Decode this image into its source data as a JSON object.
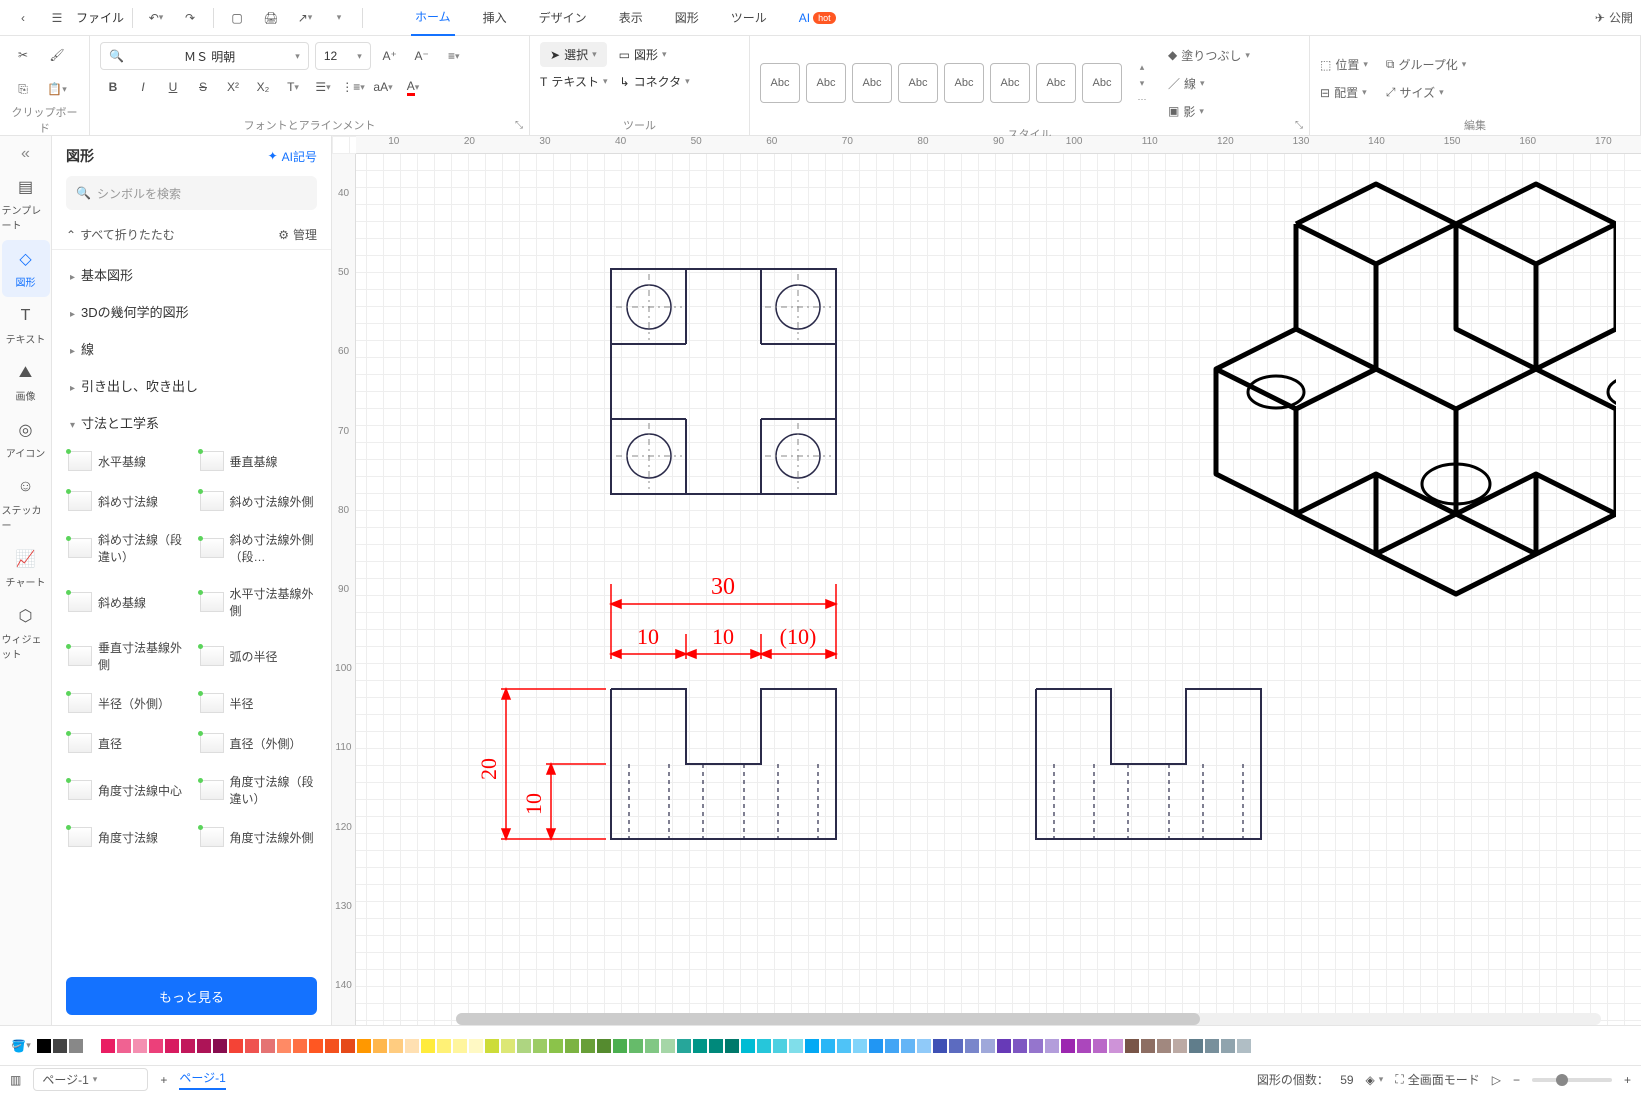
{
  "topbar": {
    "file_label": "ファイル",
    "publish": "公開"
  },
  "menu": {
    "home": "ホーム",
    "insert": "挿入",
    "design": "デザイン",
    "display": "表示",
    "shape": "図形",
    "tool": "ツール",
    "ai": "AI",
    "hot": "hot"
  },
  "ribbon": {
    "clipboard": "クリップボード",
    "font_align": "フォントとアラインメント",
    "tools": "ツール",
    "style": "スタイル",
    "edit": "編集",
    "font_name": "ＭＳ 明朝",
    "font_size": "12",
    "select": "選択",
    "shape": "図形",
    "text": "テキスト",
    "connector": "コネクタ",
    "abc": "Abc",
    "fill": "塗りつぶし",
    "line": "線",
    "shadow": "影",
    "position": "位置",
    "align": "配置",
    "group": "グループ化",
    "size": "サイズ"
  },
  "rail": {
    "template": "テンプレート",
    "shape": "図形",
    "text": "テキスト",
    "image": "画像",
    "icon": "アイコン",
    "sticker": "ステッカー",
    "chart": "チャート",
    "widget": "ウィジェット"
  },
  "panel": {
    "title": "図形",
    "ai_symbol": "AI記号",
    "search_placeholder": "シンボルを検索",
    "collapse_all": "すべて折りたたむ",
    "manage": "管理",
    "more": "もっと見る",
    "cats": {
      "basic": "基本図形",
      "geo3d": "3Dの幾何学的図形",
      "line": "線",
      "callout": "引き出し、吹き出し",
      "dim": "寸法と工学系"
    },
    "shapes": [
      "水平基線",
      "垂直基線",
      "斜め寸法線",
      "斜め寸法線外側",
      "斜め寸法線（段違い）",
      "斜め寸法線外側（段…",
      "斜め基線",
      "水平寸法基線外側",
      "垂直寸法基線外側",
      "弧の半径",
      "半径（外側）",
      "半径",
      "直径",
      "直径（外側）",
      "角度寸法線中心",
      "角度寸法線（段違い）",
      "角度寸法線",
      "角度寸法線外側"
    ]
  },
  "rulerH": [
    "10",
    "20",
    "30",
    "40",
    "50",
    "60",
    "70",
    "80",
    "90",
    "100",
    "110",
    "120",
    "130",
    "140",
    "150",
    "160",
    "170"
  ],
  "rulerV": [
    "40",
    "50",
    "60",
    "70",
    "80",
    "90",
    "100",
    "110",
    "120",
    "130",
    "140"
  ],
  "drawing": {
    "d30": "30",
    "d10a": "10",
    "d10b": "10",
    "d10c": "(10)",
    "d20": "20",
    "d10v": "10"
  },
  "status": {
    "page_sel": "ページ-1",
    "page_tab": "ページ-1",
    "shape_count_label": "図形の個数：",
    "shape_count": "59",
    "fullscreen": "全画面モード",
    "zoom_minus": "−",
    "zoom_plus": "+"
  },
  "colors": [
    "#000",
    "#444",
    "#888",
    "#fff",
    "#e91e63",
    "#f06292",
    "#f48fb1",
    "#ec407a",
    "#d81b60",
    "#c2185b",
    "#ad1457",
    "#880e4f",
    "#f44336",
    "#ef5350",
    "#e57373",
    "#ff8a65",
    "#ff7043",
    "#ff5722",
    "#f4511e",
    "#e64a19",
    "#ff9800",
    "#ffb74d",
    "#ffcc80",
    "#ffe0b2",
    "#ffeb3b",
    "#fff176",
    "#fff59d",
    "#fff9c4",
    "#cddc39",
    "#dce775",
    "#aed581",
    "#9ccc65",
    "#8bc34a",
    "#7cb342",
    "#689f38",
    "#558b2f",
    "#4caf50",
    "#66bb6a",
    "#81c784",
    "#a5d6a7",
    "#26a69a",
    "#009688",
    "#00897b",
    "#00796b",
    "#00bcd4",
    "#26c6da",
    "#4dd0e1",
    "#80deea",
    "#03a9f4",
    "#29b6f6",
    "#4fc3f7",
    "#81d4fa",
    "#2196f3",
    "#42a5f5",
    "#64b5f6",
    "#90caf9",
    "#3f51b5",
    "#5c6bc0",
    "#7986cb",
    "#9fa8da",
    "#673ab7",
    "#7e57c2",
    "#9575cd",
    "#b39ddb",
    "#9c27b0",
    "#ab47bc",
    "#ba68c8",
    "#ce93d8",
    "#795548",
    "#8d6e63",
    "#a1887f",
    "#bcaaa4",
    "#607d8b",
    "#78909c",
    "#90a4ae",
    "#b0bec5"
  ]
}
